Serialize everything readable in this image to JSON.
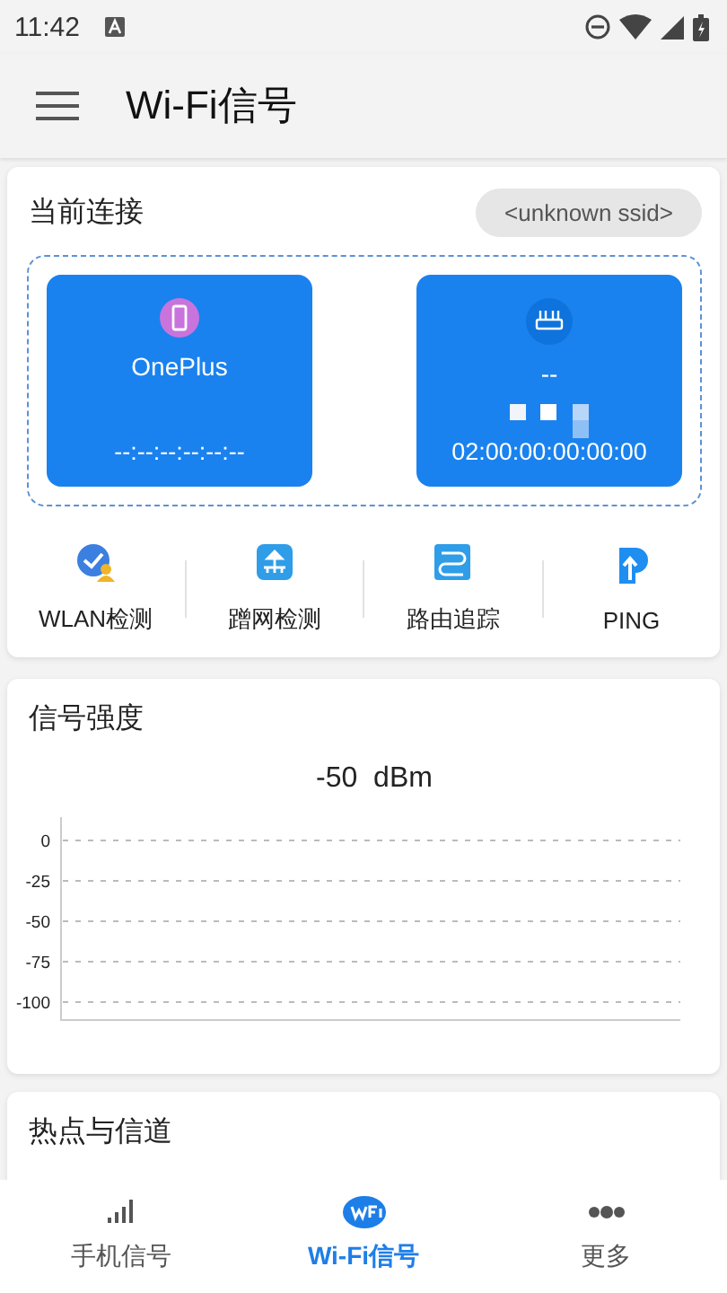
{
  "status_bar": {
    "time": "11:42"
  },
  "app_bar": {
    "title": "Wi-Fi信号"
  },
  "connection": {
    "title": "当前连接",
    "ssid": "<unknown ssid>",
    "devices": [
      {
        "kind": "phone",
        "name": "OnePlus",
        "mac": "--:--:--:--:--:--"
      },
      {
        "kind": "router",
        "name": "--",
        "mac": "02:00:00:00:00:00"
      }
    ]
  },
  "tools": [
    {
      "label": "WLAN检测"
    },
    {
      "label": "蹭网检测"
    },
    {
      "label": "路由追踪"
    },
    {
      "label": "PING"
    }
  ],
  "signal": {
    "title": "信号强度",
    "reading": "-50  dBm",
    "axis_labels": [
      "0",
      "-25",
      "-50",
      "-75",
      "-100"
    ]
  },
  "hotspot": {
    "title": "热点与信道"
  },
  "bottom_nav": [
    {
      "label": "手机信号",
      "selected": false
    },
    {
      "label": "Wi-Fi信号",
      "selected": true
    },
    {
      "label": "更多",
      "selected": false
    }
  ]
}
